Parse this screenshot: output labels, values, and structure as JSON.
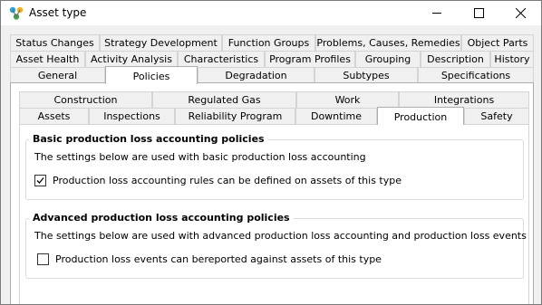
{
  "window": {
    "title": "Asset type",
    "buttons": {
      "minimize": "minimize",
      "maximize": "maximize",
      "close": "close"
    }
  },
  "outer_tabs": {
    "row1": [
      "Status Changes",
      "Strategy Development",
      "Function Groups",
      "Problems, Causes, Remedies",
      "Object Parts"
    ],
    "row2": [
      "Asset Health",
      "Activity Analysis",
      "Characteristics",
      "Program Profiles",
      "Grouping",
      "Description",
      "History"
    ],
    "row3": [
      "General",
      "Policies",
      "Degradation",
      "Subtypes",
      "Specifications"
    ],
    "active": "Policies"
  },
  "inner_tabs": {
    "row1": [
      "Construction",
      "Regulated Gas",
      "Work",
      "Integrations"
    ],
    "row2": [
      "Assets",
      "Inspections",
      "Reliability Program",
      "Downtime",
      "Production",
      "Safety"
    ],
    "active": "Production"
  },
  "basic_group": {
    "title": "Basic production loss accounting policies",
    "description": "The settings below are used with basic production loss accounting",
    "checkbox_label": "Production loss accounting rules can be defined on assets of this type",
    "checked": true
  },
  "advanced_group": {
    "title": "Advanced production loss accounting policies",
    "description": "The settings below are used with advanced production loss accounting and production loss events",
    "checkbox_label": "Production loss events can bereported against assets of this type",
    "checked": false
  },
  "colors": {
    "accent": "#0078d7",
    "border": "#adadad"
  }
}
